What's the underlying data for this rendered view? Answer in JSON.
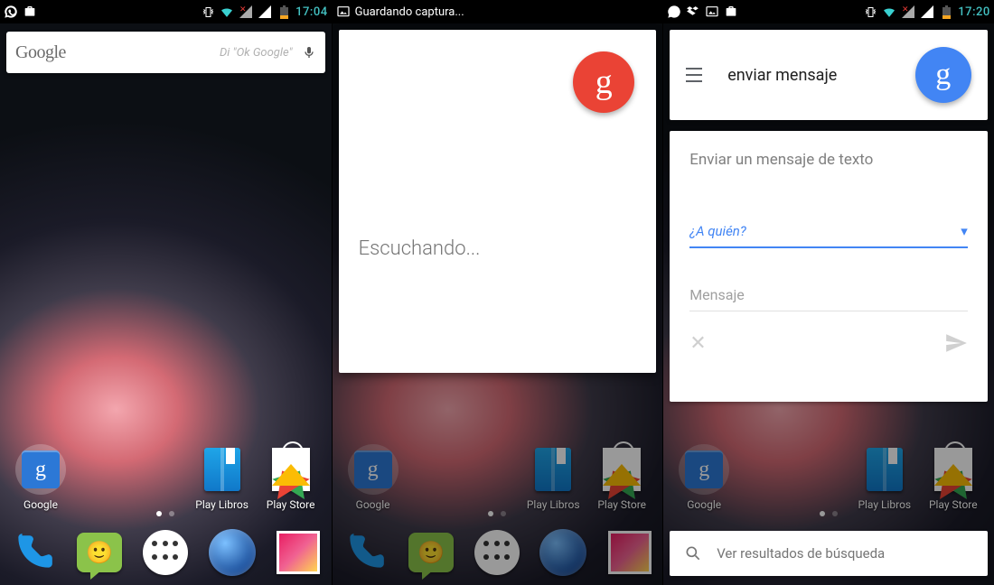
{
  "screens": [
    {
      "status": {
        "left_icons": [
          "whatsapp-icon",
          "briefcase-icon"
        ],
        "right_icons": [
          "vibrate-icon",
          "wifi-icon",
          "signal-x-icon",
          "signal-icon",
          "battery-icon"
        ],
        "time": "17:04",
        "time_color": "teal"
      },
      "search": {
        "brand": "Google",
        "hint": "Di \"Ok Google\""
      },
      "apps": [
        {
          "label": "Google"
        },
        {
          "label": "Play Libros"
        },
        {
          "label": "Play Store"
        }
      ],
      "page_indicator": {
        "count": 2,
        "active": 0
      }
    },
    {
      "status": {
        "left_icons": [
          "image-icon"
        ],
        "title": "Guardando captura...",
        "right_icons": [],
        "time": "",
        "time_color": ""
      },
      "listening_card": {
        "text": "Escuchando...",
        "fab_color": "red"
      },
      "apps": [
        {
          "label": "Google"
        },
        {
          "label": "Play Libros"
        },
        {
          "label": "Play Store"
        }
      ],
      "page_indicator": {
        "count": 2,
        "active": 0
      }
    },
    {
      "status": {
        "left_icons": [
          "whatsapp-icon",
          "dropbox-icon",
          "image-icon",
          "briefcase-icon"
        ],
        "right_icons": [
          "vibrate-icon",
          "wifi-icon",
          "signal-x-icon",
          "signal-icon",
          "battery-icon"
        ],
        "time": "17:20",
        "time_color": "teal"
      },
      "now": {
        "query": "enviar mensaje",
        "fab_color": "blue"
      },
      "compose": {
        "heading": "Enviar un mensaje de texto",
        "recipient_placeholder": "¿A quién?",
        "message_placeholder": "Mensaje"
      },
      "results_bar": {
        "label": "Ver resultados de búsqueda"
      },
      "apps": [
        {
          "label": "Google"
        },
        {
          "label": "Play Libros"
        },
        {
          "label": "Play Store"
        }
      ],
      "page_indicator": {
        "count": 2,
        "active": 0
      }
    }
  ],
  "icons": {
    "whatsapp-icon": "✆",
    "briefcase-icon": "◻",
    "dropbox-icon": "▽",
    "image-icon": "▣",
    "vibrate-icon": "◇",
    "wifi-icon": "▲",
    "signal-x-icon": "◢",
    "signal-icon": "◢",
    "battery-icon": "▮"
  }
}
